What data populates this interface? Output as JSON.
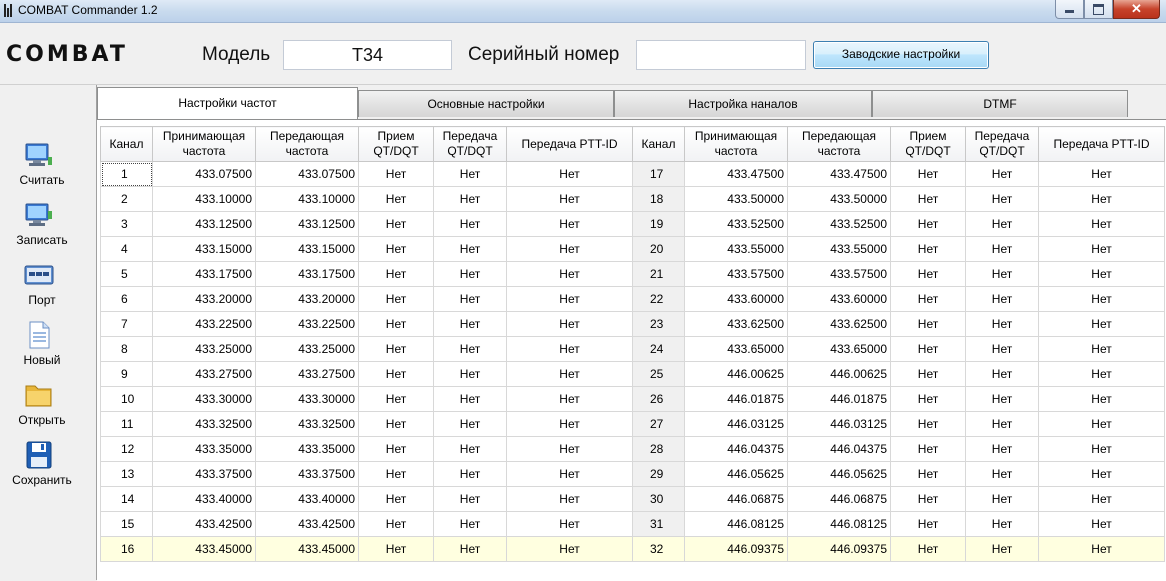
{
  "window": {
    "title": "COMBAT Commander 1.2",
    "close_glyph": "✕"
  },
  "header": {
    "brand": "COMBAT",
    "model_label": "Модель",
    "model_value": "T34",
    "serial_label": "Серийный номер",
    "serial_value": "",
    "factory_button": "Заводские настройки"
  },
  "sidebar": {
    "items": [
      {
        "label": "Считать",
        "icon": "computer-read-icon"
      },
      {
        "label": "Записать",
        "icon": "computer-write-icon"
      },
      {
        "label": "Порт",
        "icon": "port-icon"
      },
      {
        "label": "Новый",
        "icon": "new-document-icon"
      },
      {
        "label": "Открыть",
        "icon": "folder-open-icon"
      },
      {
        "label": "Сохранить",
        "icon": "floppy-save-icon"
      }
    ]
  },
  "tabs": [
    {
      "label": "Настройки частот",
      "active": true
    },
    {
      "label": "Основные настройки",
      "active": false
    },
    {
      "label": "Настройка наналов",
      "active": false
    },
    {
      "label": "DTMF",
      "active": false
    }
  ],
  "table": {
    "headers": [
      "Канал",
      "Принимающая частота",
      "Передающая частота",
      "Прием QT/DQT",
      "Передача QT/DQT",
      "Передача PTT-ID"
    ],
    "left_rows": [
      [
        "1",
        "433.07500",
        "433.07500",
        "Нет",
        "Нет",
        "Нет"
      ],
      [
        "2",
        "433.10000",
        "433.10000",
        "Нет",
        "Нет",
        "Нет"
      ],
      [
        "3",
        "433.12500",
        "433.12500",
        "Нет",
        "Нет",
        "Нет"
      ],
      [
        "4",
        "433.15000",
        "433.15000",
        "Нет",
        "Нет",
        "Нет"
      ],
      [
        "5",
        "433.17500",
        "433.17500",
        "Нет",
        "Нет",
        "Нет"
      ],
      [
        "6",
        "433.20000",
        "433.20000",
        "Нет",
        "Нет",
        "Нет"
      ],
      [
        "7",
        "433.22500",
        "433.22500",
        "Нет",
        "Нет",
        "Нет"
      ],
      [
        "8",
        "433.25000",
        "433.25000",
        "Нет",
        "Нет",
        "Нет"
      ],
      [
        "9",
        "433.27500",
        "433.27500",
        "Нет",
        "Нет",
        "Нет"
      ],
      [
        "10",
        "433.30000",
        "433.30000",
        "Нет",
        "Нет",
        "Нет"
      ],
      [
        "11",
        "433.32500",
        "433.32500",
        "Нет",
        "Нет",
        "Нет"
      ],
      [
        "12",
        "433.35000",
        "433.35000",
        "Нет",
        "Нет",
        "Нет"
      ],
      [
        "13",
        "433.37500",
        "433.37500",
        "Нет",
        "Нет",
        "Нет"
      ],
      [
        "14",
        "433.40000",
        "433.40000",
        "Нет",
        "Нет",
        "Нет"
      ],
      [
        "15",
        "433.42500",
        "433.42500",
        "Нет",
        "Нет",
        "Нет"
      ],
      [
        "16",
        "433.45000",
        "433.45000",
        "Нет",
        "Нет",
        "Нет"
      ]
    ],
    "right_rows": [
      [
        "17",
        "433.47500",
        "433.47500",
        "Нет",
        "Нет",
        "Нет"
      ],
      [
        "18",
        "433.50000",
        "433.50000",
        "Нет",
        "Нет",
        "Нет"
      ],
      [
        "19",
        "433.52500",
        "433.52500",
        "Нет",
        "Нет",
        "Нет"
      ],
      [
        "20",
        "433.55000",
        "433.55000",
        "Нет",
        "Нет",
        "Нет"
      ],
      [
        "21",
        "433.57500",
        "433.57500",
        "Нет",
        "Нет",
        "Нет"
      ],
      [
        "22",
        "433.60000",
        "433.60000",
        "Нет",
        "Нет",
        "Нет"
      ],
      [
        "23",
        "433.62500",
        "433.62500",
        "Нет",
        "Нет",
        "Нет"
      ],
      [
        "24",
        "433.65000",
        "433.65000",
        "Нет",
        "Нет",
        "Нет"
      ],
      [
        "25",
        "446.00625",
        "446.00625",
        "Нет",
        "Нет",
        "Нет"
      ],
      [
        "26",
        "446.01875",
        "446.01875",
        "Нет",
        "Нет",
        "Нет"
      ],
      [
        "27",
        "446.03125",
        "446.03125",
        "Нет",
        "Нет",
        "Нет"
      ],
      [
        "28",
        "446.04375",
        "446.04375",
        "Нет",
        "Нет",
        "Нет"
      ],
      [
        "29",
        "446.05625",
        "446.05625",
        "Нет",
        "Нет",
        "Нет"
      ],
      [
        "30",
        "446.06875",
        "446.06875",
        "Нет",
        "Нет",
        "Нет"
      ],
      [
        "31",
        "446.08125",
        "446.08125",
        "Нет",
        "Нет",
        "Нет"
      ],
      [
        "32",
        "446.09375",
        "446.09375",
        "Нет",
        "Нет",
        "Нет"
      ]
    ],
    "selected_row_index": 15
  },
  "colors": {
    "selected_row": "#ffffe0",
    "button_border": "#3c7fb1"
  }
}
